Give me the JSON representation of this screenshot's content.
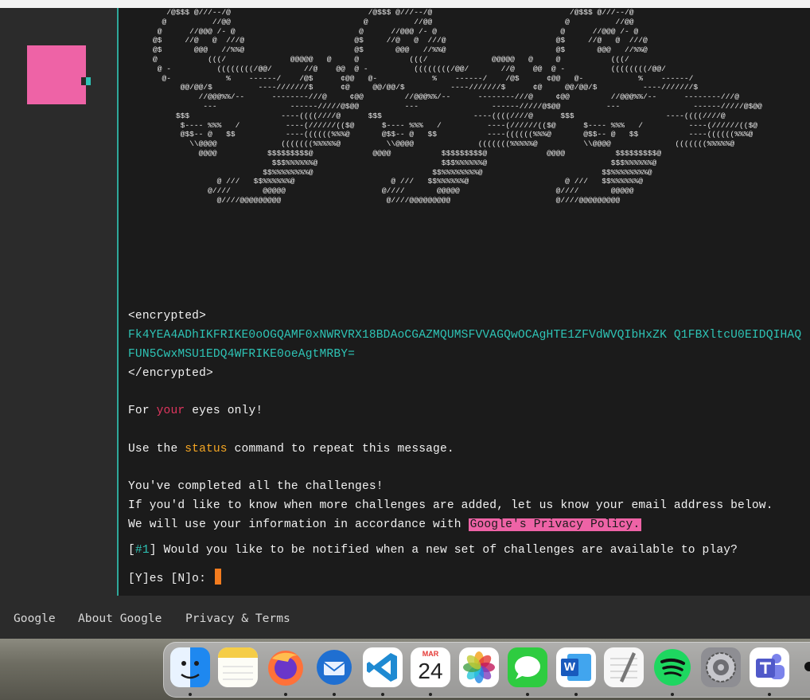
{
  "ascii_art": "       /@$$$ @///--/@                              /@$$$ @///--/@                              /@$$$ @///--/@\n      @          //@@                             @          //@@                             @          //@@\n     @      //@@@ /- @                           @      //@@@ /- @                           @      //@@@ /- @\n    @$     //@   @  ///@                        @$     //@   @  ///@                        @$     //@   @  ///@\n    @$       @@@   //%%@                        @$       @@@   //%%@                        @$       @@@   //%%@\n    @           (((/              @@@@@   @     @           (((/              @@@@@   @     @           (((/\n     @ -          ((((((((/@@/       //@    @@  @ -          ((((((((/@@/       //@    @@  @ -          ((((((((/@@/\n      @-            %    ------/    /@$      ¢@@   @-            %    ------/    /@$      ¢@@   @-            %    ------/\n          @@/@@/$          ----///////$      ¢@     @@/@@/$          ----///////$      ¢@     @@/@@/$          ----///////$\n              //@@@%%/--      --------///@     ¢@@         //@@@%%/--      --------///@     ¢@@         //@@@%%/--      --------///@\n               ---                ------/////@$@@          ---                ------/////@$@@          ---                ------/////@$@@\n         $$$                    ----((((////@      $$$                    ----((((////@      $$$                    ----((((////@\n          $---- %%%   /          ----(//////(($@      $---- %%%   /          ----(//////(($@      $---- %%%   /          ----(//////(($@\n          @$$-- @   $$           ----((((((%%%@       @$$-- @   $$           ----((((((%%%@       @$$-- @   $$           ----((((((%%%@\n            \\\\@@@@              (((((((%%%%%@          \\\\@@@@              (((((((%%%%%@          \\\\@@@@              (((((((%%%%%@\n              @@@@           $$$$$$$$$@             @@@@           $$$$$$$$$@             @@@@           $$$$$$$$$@\n                              $$$%%%%%%@                           $$$%%%%%%@                           $$$%%%%%%@\n                            $$%%%%%%%%@                          $$%%%%%%%%@                          $$%%%%%%%%@\n                  @ ///   $$%%%%%%@                     @ ///   $$%%%%%%@                     @ ///   $$%%%%%%@\n                @////       @@@@@                     @////       @@@@@                     @////       @@@@@\n                  @////@@@@@@@@@                       @////@@@@@@@@@                       @////@@@@@@@@@",
  "terminal": {
    "enc_open": "<encrypted>",
    "enc_line1": "Fk4YEA4ADhIKFRIKE0oOGQAMF0xNWRVRX18BDAoCGAZMQUMSFVVAGQwOCAgHTE1ZFVdWVQIbHxZK Q1FBXltcU0EIDQIHAQ",
    "enc_line2": "FUN5CwxMSU1EDQ4WFRIKE0oeAgtMRBY=",
    "enc_close": "</encrypted>",
    "for_pre": "For ",
    "for_word": "your",
    "for_post": " eyes only!",
    "use_pre": "Use the ",
    "use_word": "status",
    "use_post": " command to repeat this message.",
    "complete": "You've completed all the challenges!",
    "notify": "If you'd like to know when more challenges are added, let us know your email address below.",
    "policy_pre": "We will use your information in accordance with ",
    "policy_link": "Google's Privacy Policy.",
    "q_open": "[",
    "q_num": "#1",
    "q_rest": "] Would you like to be notified when a new set of challenges are available to play?",
    "prompt": "[Y]es [N]o: "
  },
  "footer": {
    "google": "Google",
    "about": "About Google",
    "privacy": "Privacy & Terms"
  },
  "colors": {
    "accent_pink": "#ee63a6",
    "accent_teal": "#2ec4b6",
    "accent_orange": "#f5a623",
    "accent_red": "#e0365f",
    "cursor": "#f37c1f"
  },
  "dock": {
    "calendar_month": "MAR",
    "calendar_day": "24",
    "word_letter": "W"
  }
}
